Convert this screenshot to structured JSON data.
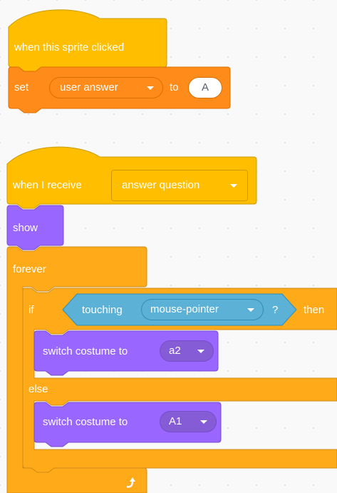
{
  "colors": {
    "events": "#FFBF00",
    "events_dark": "#CC9900",
    "variables": "#FF8C1A",
    "variables_dark": "#DB6E00",
    "looks": "#9966FF",
    "looks_dark": "#774DCB",
    "control": "#FFAB19",
    "control_dark": "#CF8B17",
    "sensing": "#5CB1D6",
    "sensing_dark": "#2E8EB8"
  },
  "script1": {
    "hat_label": "when this sprite clicked",
    "set_label": "set",
    "variable": "user answer",
    "to_label": "to",
    "value": "A"
  },
  "script2": {
    "hat_label": "when I receive",
    "message": "answer question",
    "show_label": "show",
    "forever_label": "forever",
    "if_label": "if",
    "touching_label": "touching",
    "touching_target": "mouse-pointer",
    "question_mark": "?",
    "then_label": "then",
    "switch1_label": "switch costume to",
    "switch1_costume": "a2",
    "else_label": "else",
    "switch2_label": "switch costume to",
    "switch2_costume": "A1",
    "loop_arrow_icon": "loop-arrow-icon"
  }
}
